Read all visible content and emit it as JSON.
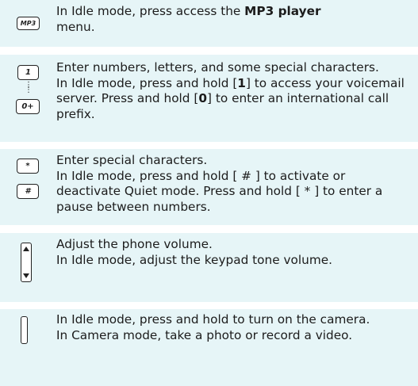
{
  "rows": [
    {
      "icon": "mp3-key-icon",
      "key_labels": [
        "MP3"
      ],
      "line1_pre": "In Idle mode, press access the ",
      "line1_bold": "MP3 player",
      "line2": "menu."
    },
    {
      "icon": "alphanumeric-keys-icon",
      "key_labels": [
        "1",
        "0+"
      ],
      "p1": "Enter numbers, letters, and some special characters.",
      "p2_a": "In Idle mode, press and hold [",
      "p2_b": "1",
      "p2_c": "] to access your voicemail server. Press and hold [",
      "p2_d": "0",
      "p2_e": "] to enter an international call prefix."
    },
    {
      "icon": "star-hash-keys-icon",
      "key_labels": [
        "*",
        "#"
      ],
      "p1": "Enter special characters.",
      "p2": "In Idle mode, press and hold [ # ] to activate or deactivate Quiet mode. Press and hold [ * ] to enter a pause between numbers."
    },
    {
      "icon": "volume-key-icon",
      "p1": "Adjust the phone volume.",
      "p2": "In Idle mode, adjust the keypad tone volume."
    },
    {
      "icon": "camera-key-icon",
      "p1": "In Idle mode, press and hold to turn on the camera.",
      "p2": "In Camera mode, take a photo or record a video."
    }
  ]
}
